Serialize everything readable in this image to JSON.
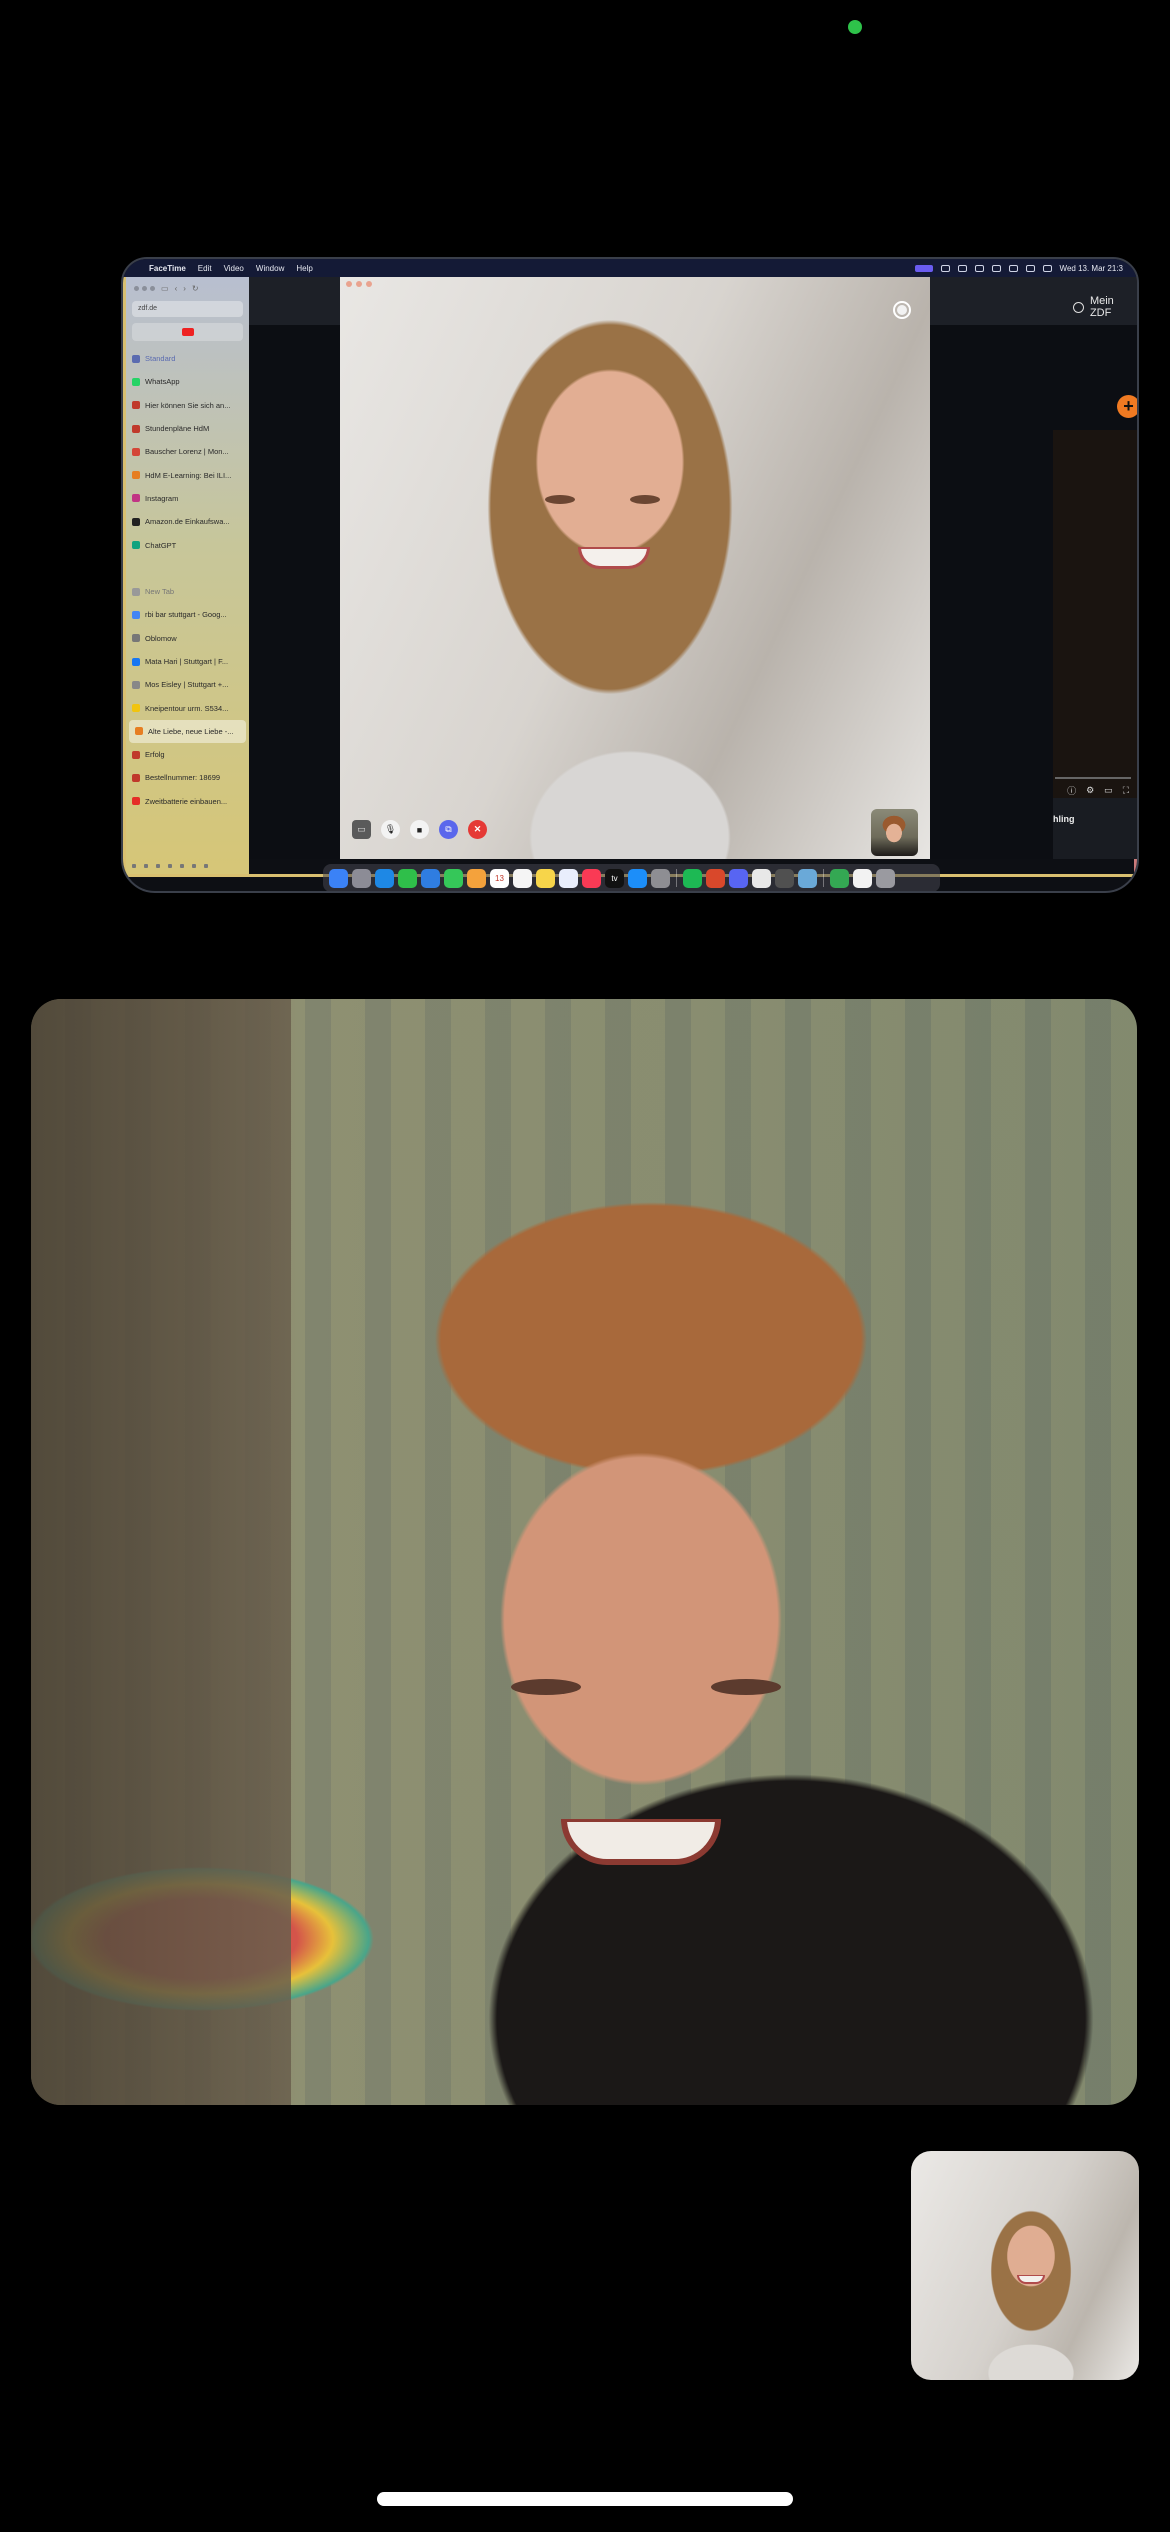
{
  "mac_menubar": {
    "apple": "",
    "app_name": "FaceTime",
    "menus": [
      "Edit",
      "Video",
      "Window",
      "Help"
    ],
    "clock": "Wed 13. Mar 21:3"
  },
  "safari_sidebar": {
    "url": "zdf.de",
    "tab_groups": [
      {
        "label": "Standard",
        "kind": "group",
        "color": "#5a6bb0"
      },
      {
        "label": "WhatsApp",
        "kind": "item",
        "color": "#25d366"
      },
      {
        "label": "Hier können Sie sich an...",
        "kind": "item",
        "color": "#c0392b"
      },
      {
        "label": "Stundenpläne HdM",
        "kind": "item",
        "color": "#c0392b"
      },
      {
        "label": "Bauscher Lorenz | Mon...",
        "kind": "item",
        "color": "#d44638"
      },
      {
        "label": "HdM E-Learning: Bei ILI...",
        "kind": "item",
        "color": "#e67e22"
      },
      {
        "label": "Instagram",
        "kind": "item",
        "color": "#c13584"
      },
      {
        "label": "Amazon.de Einkaufswa...",
        "kind": "item",
        "color": "#222222"
      },
      {
        "label": "ChatGPT",
        "kind": "item",
        "color": "#10a37f"
      },
      {
        "label": "",
        "kind": "spacer",
        "color": ""
      },
      {
        "label": "New Tab",
        "kind": "muted",
        "color": "#999999"
      },
      {
        "label": "rbi bar stuttgart - Goog...",
        "kind": "item",
        "color": "#4285f4"
      },
      {
        "label": "Oblomow",
        "kind": "item",
        "color": "#777777"
      },
      {
        "label": "Mata Hari | Stuttgart | F...",
        "kind": "item",
        "color": "#1877f2"
      },
      {
        "label": "Mos Eisley | Stuttgart +...",
        "kind": "item",
        "color": "#888888"
      },
      {
        "label": "Kneipentour urm. S534...",
        "kind": "item",
        "color": "#f1c40f"
      },
      {
        "label": "Alte Liebe, neue Liebe -...",
        "kind": "active",
        "color": "#e67e22"
      },
      {
        "label": "Erfolg",
        "kind": "item",
        "color": "#c0392b"
      },
      {
        "label": "Bestellnummer: 18699",
        "kind": "item",
        "color": "#c0392b"
      },
      {
        "label": "Zweitbatterie einbauen...",
        "kind": "item",
        "color": "#e52d27"
      }
    ]
  },
  "zdf_window": {
    "account_label": "Mein ZDF",
    "plus_label": "+",
    "caption": "hling",
    "player_icons": [
      "info-icon",
      "settings-icon",
      "subtitles-icon",
      "fullscreen-icon"
    ]
  },
  "facetime_controls": {
    "sidebar": "▭",
    "mic": "🎙",
    "camera": "■",
    "share": "⧉",
    "end": "✕"
  },
  "dock": {
    "apps": [
      {
        "name": "Finder",
        "color": "#3b82f6"
      },
      {
        "name": "Launchpad",
        "color": "#8c8c96"
      },
      {
        "name": "Safari",
        "color": "#1e88e5"
      },
      {
        "name": "FaceTime",
        "color": "#2fbf4a"
      },
      {
        "name": "Mail",
        "color": "#2f7de1"
      },
      {
        "name": "Messages",
        "color": "#35c759"
      },
      {
        "name": "Photos",
        "color": "#f4a23c"
      },
      {
        "name": "Calendar",
        "color": "#ffffff",
        "text": "13"
      },
      {
        "name": "Reminders",
        "color": "#f5f5f5"
      },
      {
        "name": "Notes",
        "color": "#f7d54a"
      },
      {
        "name": "Freeform",
        "color": "#e9eefc"
      },
      {
        "name": "Music",
        "color": "#fa3a55"
      },
      {
        "name": "TV",
        "color": "#111111",
        "text": "tv"
      },
      {
        "name": "App Store",
        "color": "#1c8ef9"
      },
      {
        "name": "System Settings",
        "color": "#8e8e93"
      },
      {
        "name": "sep",
        "color": ""
      },
      {
        "name": "Spotify",
        "color": "#1db954"
      },
      {
        "name": "Affinity",
        "color": "#d9482b"
      },
      {
        "name": "Discord",
        "color": "#5865f2"
      },
      {
        "name": "Notes App",
        "color": "#e8e8e8"
      },
      {
        "name": "Calculator",
        "color": "#505050"
      },
      {
        "name": "Preview",
        "color": "#6aa9d8"
      },
      {
        "name": "sep",
        "color": ""
      },
      {
        "name": "Chrome",
        "color": "#34a853"
      },
      {
        "name": "Document",
        "color": "#f2f2f2"
      },
      {
        "name": "Trash",
        "color": "#9a9aa0"
      }
    ]
  }
}
